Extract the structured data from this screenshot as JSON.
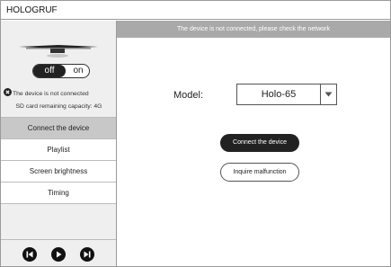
{
  "window": {
    "title": "HOLOGRUF"
  },
  "sidebar": {
    "power_toggle": {
      "off_label": "off",
      "on_label": "on",
      "state": "off"
    },
    "status_text": "The device is not connected",
    "status_icon": "x-circle-icon",
    "sd_card_text": "SD card remaining capacity: 4G",
    "menu": [
      {
        "label": "Connect the device",
        "active": true
      },
      {
        "label": "Playlist",
        "active": false
      },
      {
        "label": "Screen brightness",
        "active": false
      },
      {
        "label": "Timing",
        "active": false
      }
    ],
    "controls": [
      "previous-icon",
      "play-icon",
      "next-icon"
    ]
  },
  "main": {
    "banner": "The device is not connected, please check the network",
    "model_label": "Model:",
    "model_select": {
      "value": "Holo-65"
    },
    "connect_button": "Connect the device",
    "inquire_button": "Inquire malfunction"
  },
  "colors": {
    "banner_bg": "#a9a9a9",
    "sidebar_bg": "#efefef",
    "active_item_bg": "#c8c8c8",
    "button_dark": "#222222"
  }
}
